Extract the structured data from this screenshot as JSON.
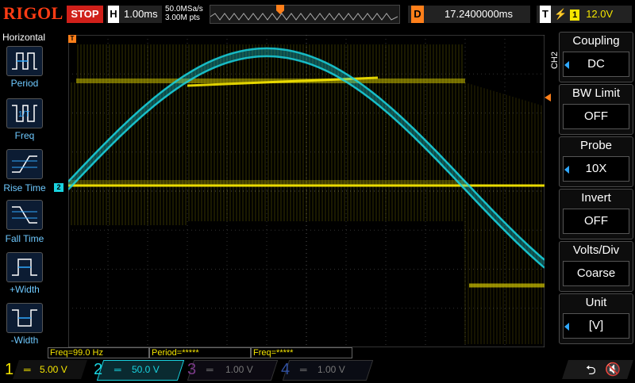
{
  "brand": "RIGOL",
  "run_state": "STOP",
  "horizontal": {
    "label": "H",
    "scale": "1.00ms"
  },
  "acquisition": {
    "sample_rate": "50.0MSa/s",
    "memory_depth": "3.00M pts"
  },
  "delay": {
    "label": "D",
    "value": "17.2400000ms"
  },
  "trigger": {
    "label": "T",
    "source": "1",
    "level": "12.0V"
  },
  "left_menu": {
    "title": "Horizontal",
    "items": [
      {
        "label": "Period",
        "icon": "period-icon"
      },
      {
        "label": "Freq",
        "icon": "frequency-icon"
      },
      {
        "label": "Rise Time",
        "icon": "rise-time-icon"
      },
      {
        "label": "Fall Time",
        "icon": "fall-time-icon"
      },
      {
        "label": "+Width",
        "icon": "positive-width-icon"
      },
      {
        "label": "-Width",
        "icon": "negative-width-icon"
      }
    ]
  },
  "right_menu": {
    "channel_tag": "CH2",
    "items": [
      {
        "label": "Coupling",
        "value": "DC"
      },
      {
        "label": "BW Limit",
        "value": "OFF"
      },
      {
        "label": "Probe",
        "value": "10X"
      },
      {
        "label": "Invert",
        "value": "OFF"
      },
      {
        "label": "Volts/Div",
        "value": "Coarse"
      },
      {
        "label": "Unit",
        "value": "[V]"
      }
    ]
  },
  "measurements": {
    "m1": "Freq=99.0 Hz",
    "m2": "Period=*****",
    "m3": "Freq=*****"
  },
  "channels": [
    {
      "num": "1",
      "scale": "5.00 V",
      "color": "#f5e600"
    },
    {
      "num": "2",
      "scale": "50.0 V",
      "color": "#00e0f0"
    },
    {
      "num": "3",
      "scale": "1.00 V",
      "color": "#b040c0"
    },
    {
      "num": "4",
      "scale": "1.00 V",
      "color": "#2060ff"
    }
  ],
  "markers": {
    "ch2_ref": "2",
    "trig_marker": "T"
  },
  "colors": {
    "ch1": "#f5e600",
    "ch2": "#19d3e0",
    "trigger": "#ff7f1a",
    "menu_accent": "#2fa8ff"
  }
}
